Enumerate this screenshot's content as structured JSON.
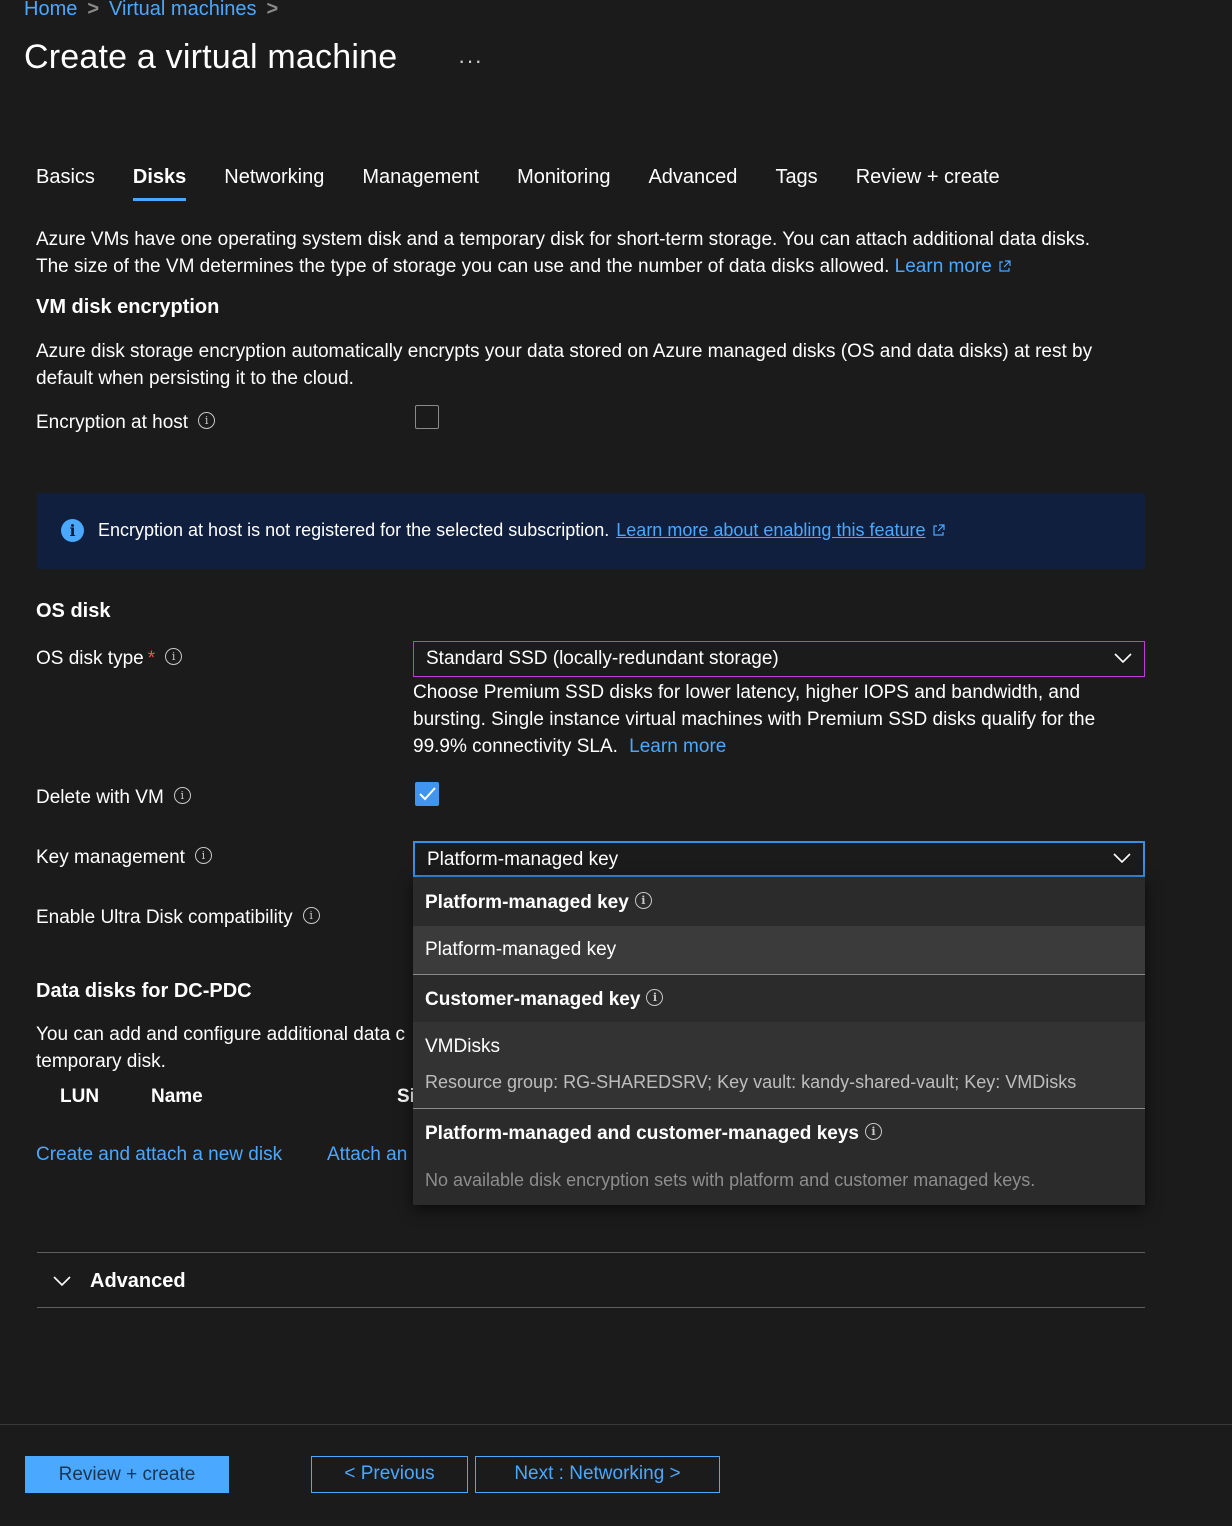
{
  "breadcrumb": {
    "items": [
      "Home",
      "Virtual machines"
    ]
  },
  "page": {
    "title": "Create a virtual machine",
    "more": "···"
  },
  "tabs": [
    "Basics",
    "Disks",
    "Networking",
    "Management",
    "Monitoring",
    "Advanced",
    "Tags",
    "Review + create"
  ],
  "active_tab": "Disks",
  "intro": {
    "line1": "Azure VMs have one operating system disk and a temporary disk for short-term storage. You can attach additional data disks.",
    "line2": "The size of the VM determines the type of storage you can use and the number of data disks allowed.",
    "learn_more": "Learn more"
  },
  "encryption": {
    "heading": "VM disk encryption",
    "desc1": "Azure disk storage encryption automatically encrypts your data stored on Azure managed disks (OS and data disks) at rest by",
    "desc2": "default when persisting it to the cloud.",
    "host_label": "Encryption at host",
    "host_checked": false
  },
  "banner": {
    "text": "Encryption at host is not registered for the selected subscription.",
    "link": "Learn more about enabling this feature"
  },
  "os_disk": {
    "heading": "OS disk",
    "type_label": "OS disk type",
    "required": "*",
    "type_value": "Standard SSD (locally-redundant storage)",
    "help1": "Choose Premium SSD disks for lower latency, higher IOPS and bandwidth, and",
    "help2": "bursting. Single instance virtual machines with Premium SSD disks qualify for the",
    "help3": "99.9% connectivity SLA.",
    "help_link": "Learn more",
    "delete_label": "Delete with VM",
    "delete_checked": true,
    "key_label": "Key management",
    "key_value": "Platform-managed key",
    "ultra_label": "Enable Ultra Disk compatibility"
  },
  "key_dropdown": {
    "group1": "Platform-managed key",
    "option1": "Platform-managed key",
    "group2": "Customer-managed key",
    "option2_title": "VMDisks",
    "option2_detail": "Resource group: RG-SHAREDSRV; Key vault: kandy-shared-vault; Key: VMDisks",
    "group3": "Platform-managed and customer-managed keys",
    "group3_empty": "No available disk encryption sets with platform and customer managed keys."
  },
  "data_disks": {
    "heading": "Data disks for DC-PDC",
    "desc1": "You can add and configure additional data c",
    "desc2": "temporary disk.",
    "col_lun": "LUN",
    "col_name": "Name",
    "col_size": "Si",
    "create_link": "Create and attach a new disk",
    "attach_link": "Attach an"
  },
  "advanced": {
    "label": "Advanced"
  },
  "footer": {
    "review": "Review + create",
    "previous": "< Previous",
    "next": "Next : Networking >"
  },
  "colors": {
    "accent": "#4aa8ff",
    "background": "#1b1b1b",
    "banner": "#0f1f3d",
    "focus_purple": "#c239d9"
  }
}
